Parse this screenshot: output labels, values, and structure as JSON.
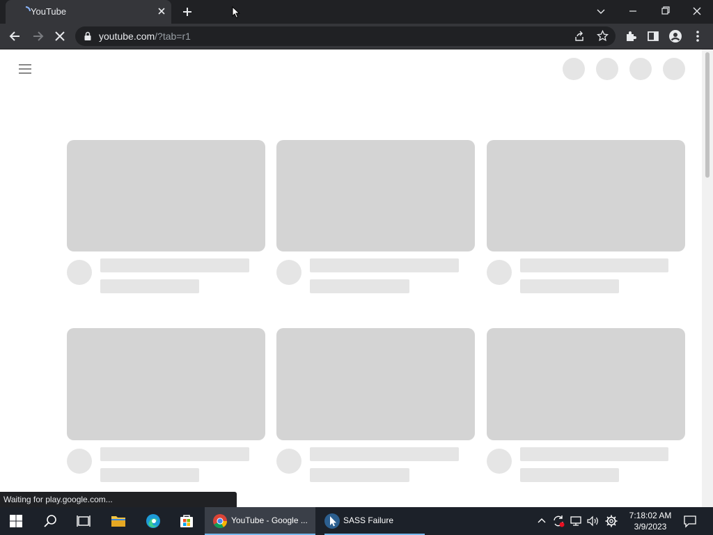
{
  "browser": {
    "tab": {
      "title": "YouTube",
      "favicon": "loading-spinner-icon",
      "close": "close-icon"
    },
    "new_tab": "plus-icon",
    "window_controls": [
      "tab-search-icon",
      "minimize-icon",
      "restore-icon",
      "close-icon"
    ],
    "address": {
      "host": "youtube.com",
      "path": "/?tab=r1"
    },
    "toolbar_icons": [
      "back-arrow-icon",
      "forward-arrow-icon",
      "stop-loading-icon",
      "lock-icon",
      "share-icon",
      "star-icon",
      "extensions-icon",
      "side-panel-icon",
      "profile-icon",
      "more-vert-icon"
    ],
    "status_text": "Waiting for play.google.com..."
  },
  "page": {
    "state": "loading-skeleton",
    "top_circles": 4,
    "grid_rows": 2,
    "grid_cols": 3
  },
  "taskbar": {
    "apps": [
      {
        "label": "YouTube - Google ...",
        "icon": "chrome-icon",
        "active": true
      },
      {
        "label": "SASS Failure",
        "icon": "cursor-app-icon",
        "active": false
      }
    ],
    "clock": {
      "time": "7:18:02 AM",
      "date": "3/9/2023"
    }
  },
  "colors": {
    "chrome_dark": "#202124",
    "chrome_toolbar": "#35363a",
    "skeleton_thumb": "#d4d4d4",
    "skeleton_line": "#e5e5e5",
    "taskbar": "#1c2129",
    "accent": "#76b9ed"
  }
}
